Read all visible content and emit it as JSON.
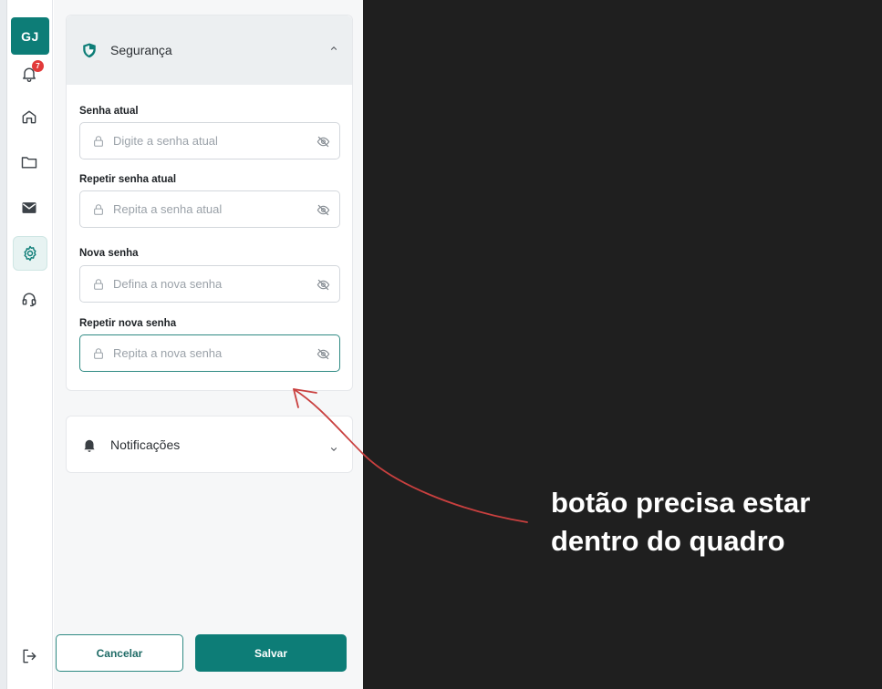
{
  "sidebar": {
    "avatar_initials": "GJ",
    "notification_count": "7",
    "icons": [
      "bell-icon",
      "home-icon",
      "folder-icon",
      "mail-icon",
      "gear-icon",
      "headset-icon",
      "logout-icon"
    ]
  },
  "security": {
    "title": "Segurança",
    "fields": [
      {
        "label": "Senha atual",
        "placeholder": "Digite a senha atual"
      },
      {
        "label": "Repetir senha atual",
        "placeholder": "Repita a senha atual"
      },
      {
        "label": "Nova senha",
        "placeholder": "Defina a nova senha"
      },
      {
        "label": "Repetir nova senha",
        "placeholder": "Repita a nova senha"
      }
    ]
  },
  "notifications": {
    "title": "Notificações"
  },
  "footer": {
    "cancel_label": "Cancelar",
    "save_label": "Salvar"
  },
  "annotation": {
    "line1": "botão precisa estar",
    "line2": "dentro do quadro"
  },
  "colors": {
    "accent": "#0d7d77",
    "badge": "#e23a3a",
    "annotation_arrow": "#c9403f"
  }
}
